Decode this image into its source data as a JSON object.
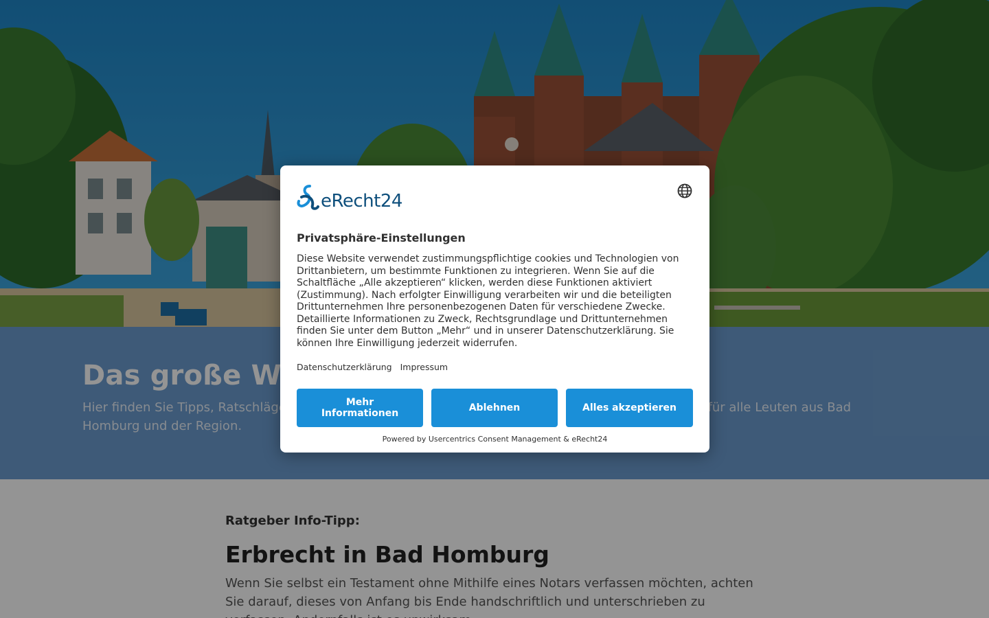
{
  "intro": {
    "title": "Das große Wissen für Bad Homburg",
    "text": "Hier finden Sie Tipps, Ratschläge und Wissenswertes rund um verschiedene Themen – von Experten für alle Leuten aus Bad Homburg und der Region."
  },
  "article": {
    "kicker": "Ratgeber Info-Tipp:",
    "title": "Erbrecht in Bad Homburg",
    "text": "Wenn Sie selbst ein Testament ohne Mithilfe eines Notars verfassen möchten, achten Sie darauf, dieses von Anfang bis Ende handschriftlich und unterschrieben zu verfassen. Andernfalls ist es unwirksam."
  },
  "consent": {
    "logo_text": "eRecht24",
    "language_icon": "globe-icon",
    "title": "Privatsphäre-Einstellungen",
    "body": "Diese Website verwendet zustimmungspflichtige cookies und Technologien von Drittanbietern, um bestimmte Funktionen zu integrieren. Wenn Sie auf die Schaltfläche „Alle akzeptieren“ klicken, werden diese Funktionen aktiviert (Zustimmung). Nach erfolgter Einwilligung verarbeiten wir und die beteiligten Drittunternehmen Ihre personenbezogenen Daten für verschiedene Zwecke. Detaillierte Informationen zu Zweck, Rechtsgrundlage und Drittunternehmen finden Sie unter dem Button „Mehr“ und in unserer Datenschutzerklärung. Sie können Ihre Einwilligung jederzeit widerrufen.",
    "link_privacy": "Datenschutzerklärung",
    "link_imprint": "Impressum",
    "btn_more": "Mehr Informationen",
    "btn_deny": "Ablehnen",
    "btn_accept": "Alles akzeptieren",
    "powered_by": "Powered by Usercentrics Consent Management & eRecht24"
  },
  "colors": {
    "button": "#1a8fd8",
    "logo": "#0e4f7c",
    "intro_band": "#6c9ccf"
  }
}
